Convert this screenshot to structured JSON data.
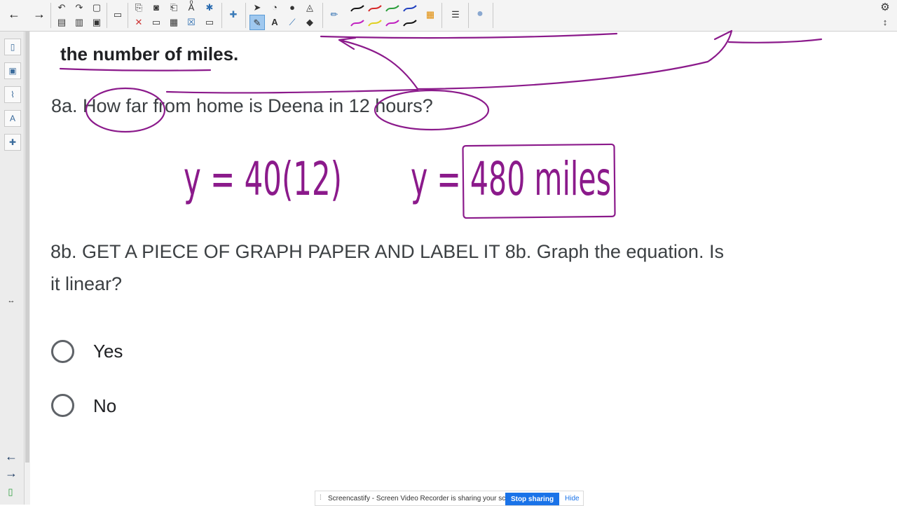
{
  "document": {
    "line_fragment": "the number of miles.",
    "q8a": "8a. How far from home is Deena in 12 hours?",
    "q8b_line1": "8b. GET A PIECE OF GRAPH PAPER AND LABEL IT 8b. Graph the equation. Is",
    "q8b_line2": "it linear?",
    "options": [
      "Yes",
      "No"
    ]
  },
  "handwriting": {
    "equation_1": "y = 40(12)",
    "equation_2": "y = 480 miles",
    "ink_color": "#8b1a8b"
  },
  "toolbar": {
    "icons": [
      "back-arrow-icon",
      "forward-arrow-icon",
      "undo-icon",
      "redo-icon",
      "new-page-icon",
      "copy-icon",
      "camera-icon",
      "screen-shade-icon",
      "handwriting-recognition-icon",
      "add-on-icon",
      "select-icon",
      "shape-icon",
      "fill-icon",
      "pen-icon",
      "line-icon",
      "eraser-icon",
      "text-icon",
      "color-palette-icon",
      "properties-icon",
      "sphere-icon"
    ],
    "pen_colors": [
      "#111111",
      "#d62828",
      "#2a9d3a",
      "#1f3fbf",
      "#c020c0",
      "#e0d020",
      "#c020c0",
      "#111111"
    ]
  },
  "share_banner": {
    "message": "Screencastify - Screen Video Recorder is sharing your screen.",
    "stop_label": "Stop sharing",
    "hide_label": "Hide"
  }
}
